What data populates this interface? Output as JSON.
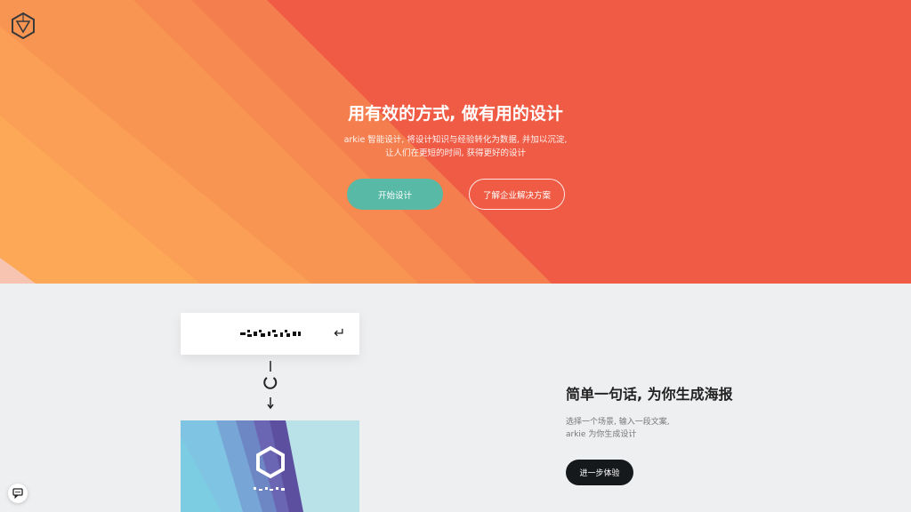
{
  "hero": {
    "title": "用有效的方式, 做有用的设计",
    "subtitle_line1": "arkie 智能设计, 将设计知识与经验转化为数据, 并加以沉淀,",
    "subtitle_line2": "让人们在更短的时间, 获得更好的设计",
    "start_button": "开始设计",
    "enterprise_button": "了解企业解决方案"
  },
  "icons": {
    "logo": "hexagon-logo-icon",
    "return": "return-key-icon",
    "loading": "loading-spinner-icon",
    "chat": "chat-icon"
  },
  "demo": {
    "return_symbol": "↵"
  },
  "feature": {
    "title": "简单一句话, 为你生成海报",
    "desc_line1": "选择一个场景, 输入一段文案,",
    "desc_line2": "arkie 为你生成设计",
    "button": "进一步体验"
  },
  "colors": {
    "hero_base": "#ef5b44",
    "accent_green": "#57b9a6",
    "dark_button": "#16191c",
    "poster_bg": "#b9e2e8"
  }
}
